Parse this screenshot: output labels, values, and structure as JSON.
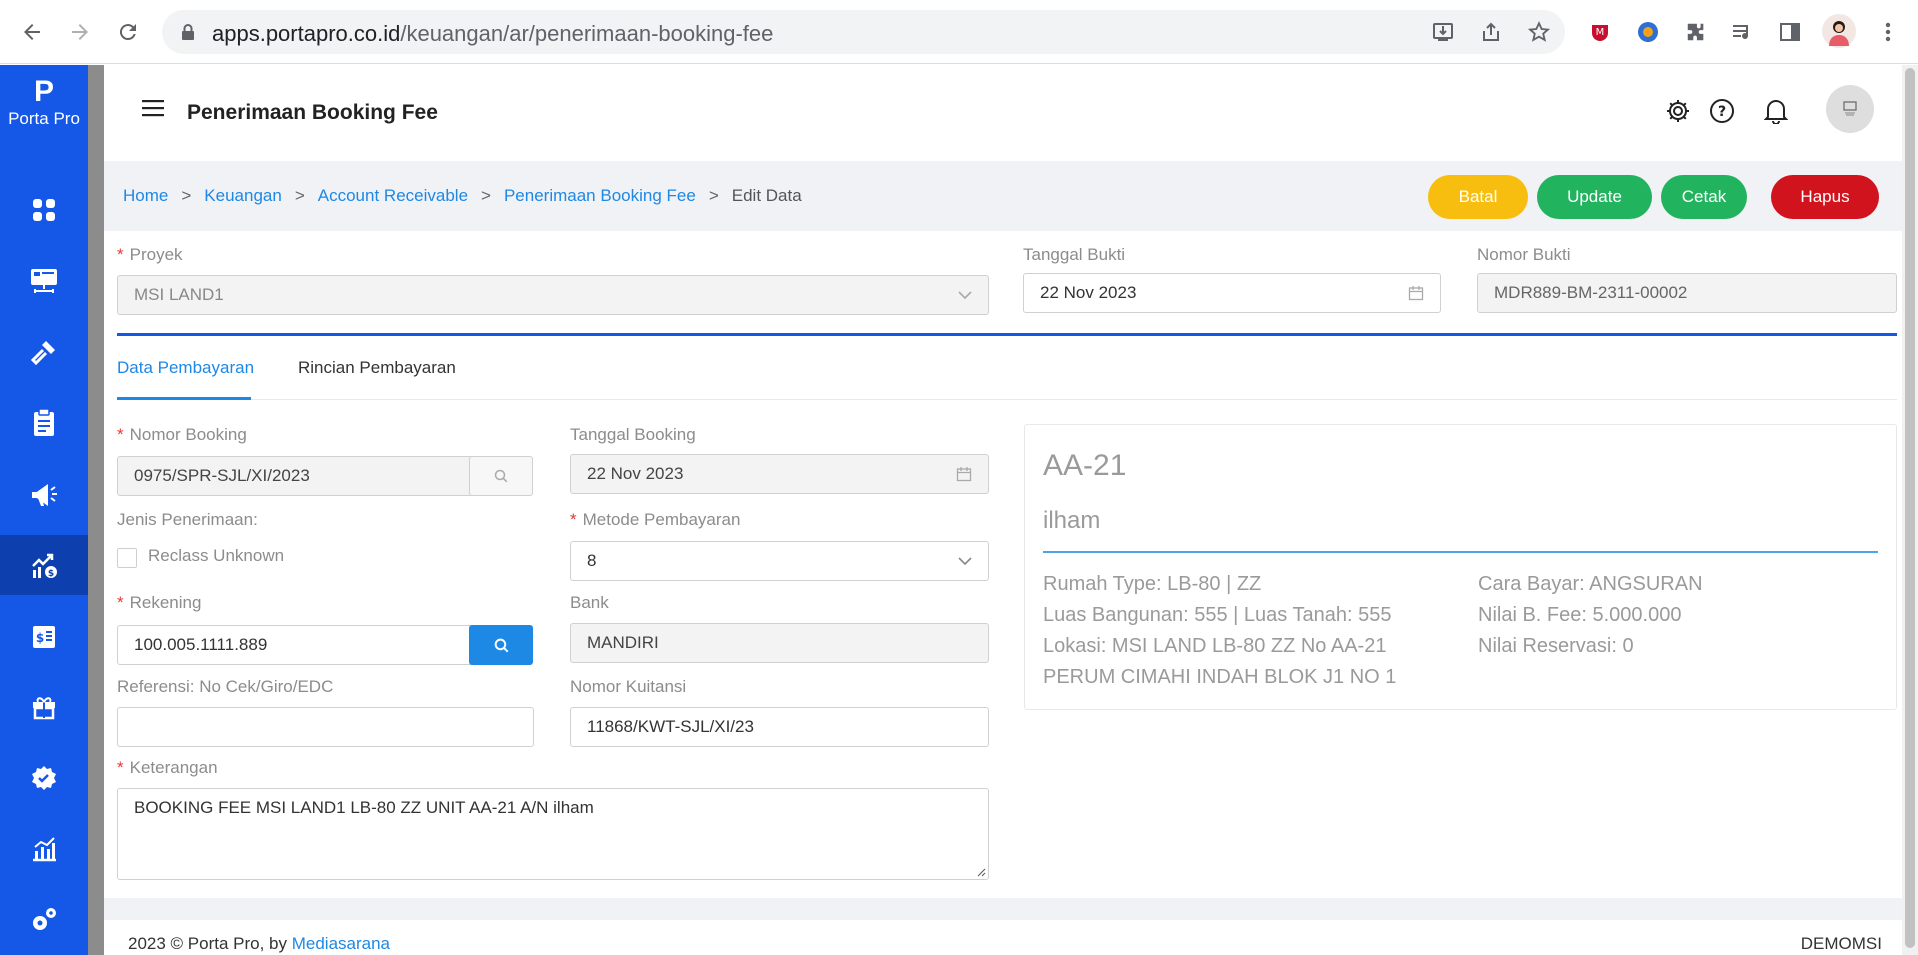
{
  "browser": {
    "url_host": "apps.portapro.co.id",
    "url_path": "/keuangan/ar/penerimaan-booking-fee"
  },
  "brand": {
    "logo": "P",
    "name": "Porta Pro"
  },
  "sidebar": {
    "items": [
      {
        "icon": "dashboard-icon"
      },
      {
        "icon": "projects-icon"
      },
      {
        "icon": "construction-icon"
      },
      {
        "icon": "clipboard-icon"
      },
      {
        "icon": "marketing-icon"
      },
      {
        "icon": "finance-icon",
        "active": true
      },
      {
        "icon": "cashier-icon"
      },
      {
        "icon": "gift-icon"
      },
      {
        "icon": "verified-icon"
      },
      {
        "icon": "report-chart-icon"
      },
      {
        "icon": "settings-gears-icon"
      }
    ]
  },
  "header": {
    "title": "Penerimaan Booking Fee"
  },
  "breadcrumb": {
    "home": "Home",
    "keuangan": "Keuangan",
    "ar": "Account Receivable",
    "pbf": "Penerimaan Booking Fee",
    "current": "Edit Data",
    "sep": ">"
  },
  "actions": {
    "batal": "Batal",
    "update": "Update",
    "cetak": "Cetak",
    "hapus": "Hapus",
    "colors": {
      "batal": "#f7be0f",
      "update": "#22b35e",
      "cetak": "#22b35e",
      "hapus": "#d0131c"
    }
  },
  "form": {
    "proyek_label": "Proyek",
    "proyek_value": "MSI LAND1",
    "tanggal_bukti_label": "Tanggal Bukti",
    "tanggal_bukti_value": "22 Nov 2023",
    "nomor_bukti_label": "Nomor Bukti",
    "nomor_bukti_value": "MDR889-BM-2311-00002"
  },
  "tabs": {
    "data_pembayaran": "Data Pembayaran",
    "rincian_pembayaran": "Rincian Pembayaran"
  },
  "detail": {
    "nomor_booking_label": "Nomor Booking",
    "nomor_booking_value": "0975/SPR-SJL/XI/2023",
    "tanggal_booking_label": "Tanggal Booking",
    "tanggal_booking_value": "22 Nov 2023",
    "jenis_penerimaan_label": "Jenis Penerimaan:",
    "reclass_label": "Reclass Unknown",
    "metode_label": "Metode Pembayaran",
    "metode_value": "8",
    "rekening_label": "Rekening",
    "rekening_value": "100.005.1111.889",
    "bank_label": "Bank",
    "bank_value": "MANDIRI",
    "referensi_label": "Referensi: No Cek/Giro/EDC",
    "referensi_value": "",
    "nomor_kuitansi_label": "Nomor Kuitansi",
    "nomor_kuitansi_value": "11868/KWT-SJL/XI/23",
    "keterangan_label": "Keterangan",
    "keterangan_value": "BOOKING FEE MSI LAND1 LB-80 ZZ UNIT AA-21 A/N ilham"
  },
  "card": {
    "unit": "AA-21",
    "customer": "ilham",
    "rumah_type": "Rumah Type: LB-80 | ZZ",
    "luas": "Luas Bangunan: 555 | Luas Tanah: 555",
    "lokasi": "Lokasi: MSI LAND LB-80 ZZ No AA-21",
    "alamat": "PERUM CIMAHI INDAH BLOK J1 NO 1",
    "cara_bayar": "Cara Bayar: ANGSURAN",
    "nilai_bfee": "Nilai B. Fee: 5.000.000",
    "nilai_reservasi": "Nilai Reservasi: 0"
  },
  "footer": {
    "copyright": "2023 © Porta Pro, by ",
    "company": "Mediasarana",
    "user": "DEMOMSI"
  }
}
